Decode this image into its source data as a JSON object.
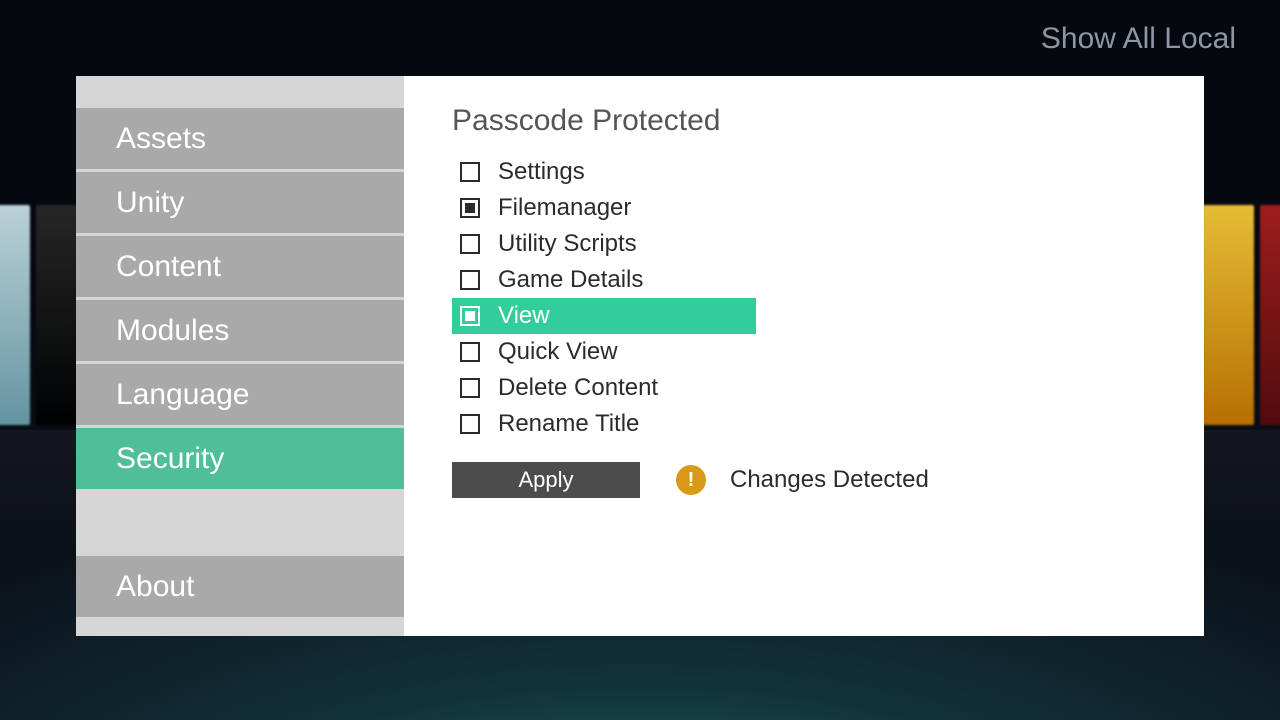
{
  "header": {
    "top_right": "Show All Local"
  },
  "sidebar": {
    "items": [
      {
        "label": "Assets",
        "selected": false
      },
      {
        "label": "Unity",
        "selected": false
      },
      {
        "label": "Content",
        "selected": false
      },
      {
        "label": "Modules",
        "selected": false
      },
      {
        "label": "Language",
        "selected": false
      },
      {
        "label": "Security",
        "selected": true
      }
    ],
    "footer_item": {
      "label": "About"
    }
  },
  "content": {
    "section_title": "Passcode Protected",
    "options": [
      {
        "label": "Settings",
        "checked": false,
        "highlight": false
      },
      {
        "label": "Filemanager",
        "checked": true,
        "highlight": false
      },
      {
        "label": "Utility Scripts",
        "checked": false,
        "highlight": false
      },
      {
        "label": "Game Details",
        "checked": false,
        "highlight": false
      },
      {
        "label": "View",
        "checked": true,
        "highlight": true
      },
      {
        "label": "Quick View",
        "checked": false,
        "highlight": false
      },
      {
        "label": "Delete Content",
        "checked": false,
        "highlight": false
      },
      {
        "label": "Rename Title",
        "checked": false,
        "highlight": false
      }
    ],
    "apply_label": "Apply",
    "status_text": "Changes Detected",
    "warning_glyph": "!"
  },
  "colors": {
    "accent": "#4fbf99",
    "highlight": "#31cd9a",
    "warn": "#d99a1a"
  }
}
